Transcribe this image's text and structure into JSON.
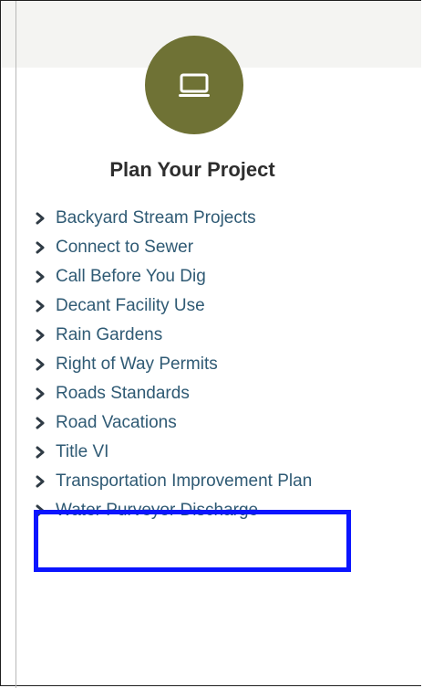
{
  "section": {
    "icon": "laptop-icon",
    "title": "Plan Your Project",
    "accent_color": "#6f7235",
    "link_color": "#2f5a74",
    "highlight_color": "#0b15ff"
  },
  "links": [
    {
      "label": "Backyard Stream Projects"
    },
    {
      "label": "Connect to Sewer"
    },
    {
      "label": "Call Before You Dig"
    },
    {
      "label": "Decant Facility Use"
    },
    {
      "label": "Rain Gardens"
    },
    {
      "label": "Right of Way Permits"
    },
    {
      "label": "Roads Standards"
    },
    {
      "label": "Road Vacations"
    },
    {
      "label": "Title VI"
    },
    {
      "label": "Transportation Improvement Plan",
      "highlighted": true
    },
    {
      "label": "Water Purveyor Discharge"
    }
  ]
}
